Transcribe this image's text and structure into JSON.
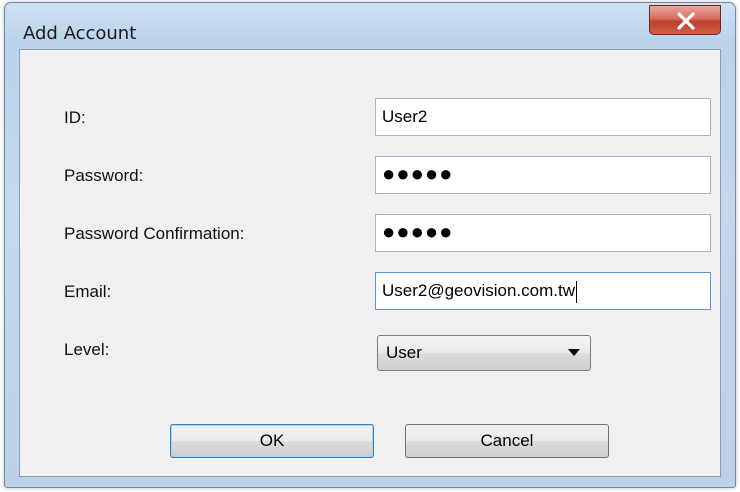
{
  "window": {
    "title": "Add Account",
    "close_icon": "close-icon"
  },
  "form": {
    "id_label": "ID:",
    "id_value": "User2",
    "password_label": "Password:",
    "password_value": "●●●●●",
    "password_confirm_label": "Password Confirmation:",
    "password_confirm_value": "●●●●●",
    "email_label": "Email:",
    "email_value": "User2@geovision.com.tw",
    "level_label": "Level:",
    "level_value": "User"
  },
  "buttons": {
    "ok_label": "OK",
    "cancel_label": "Cancel"
  },
  "colors": {
    "close_button": "#c0402b",
    "focus_border": "#5b8fcf",
    "default_button_border": "#3c7fb1"
  }
}
